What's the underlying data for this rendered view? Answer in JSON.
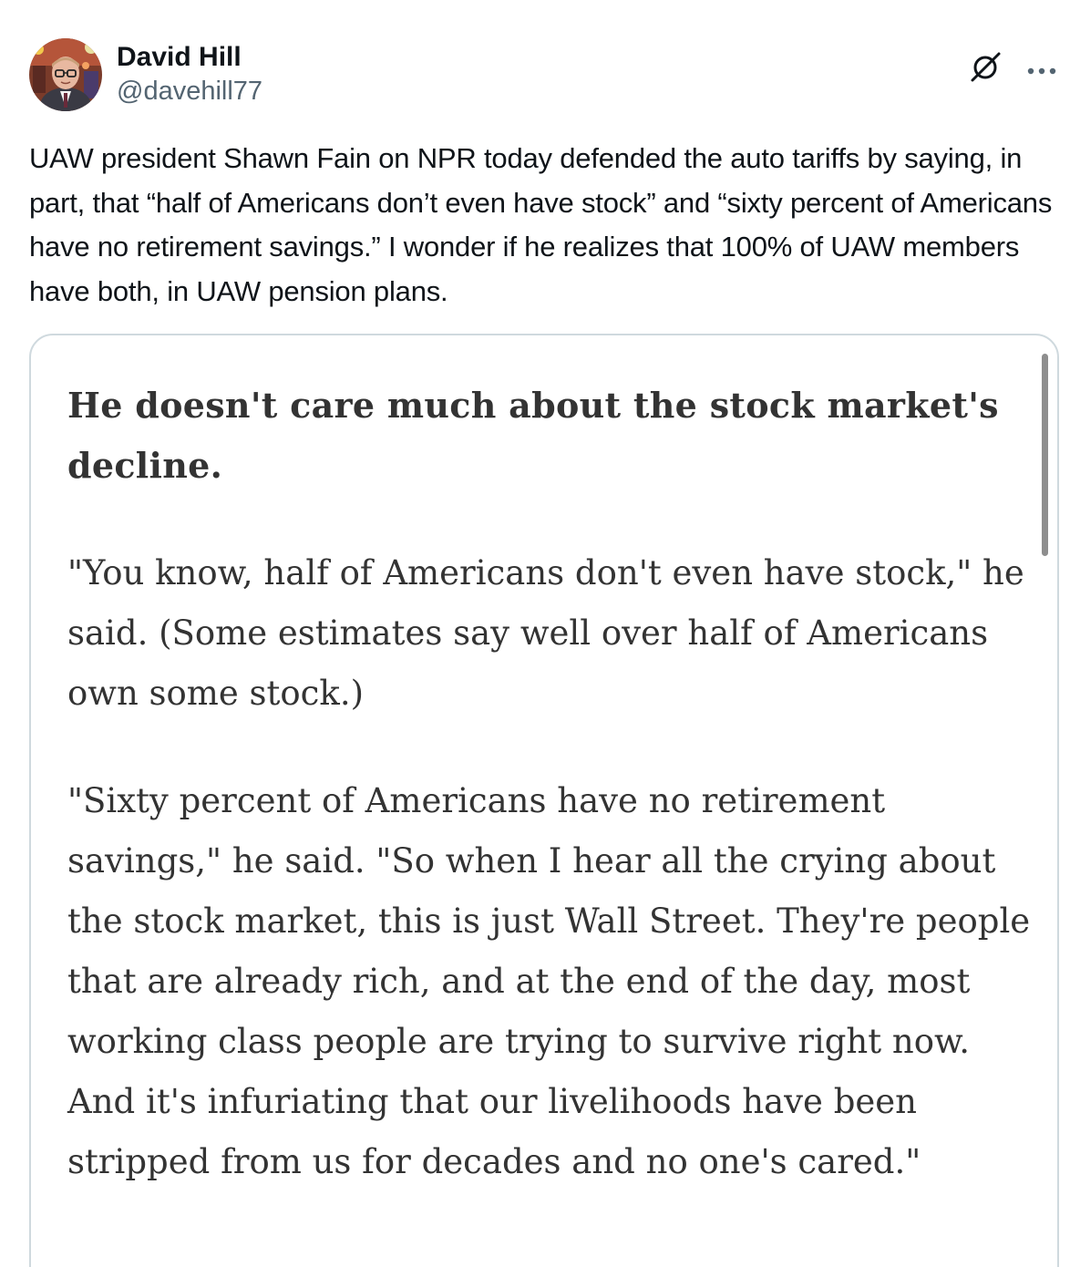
{
  "tweet": {
    "author": {
      "name": "David Hill",
      "handle": "@davehill77",
      "avatar_icon": "profile-photo"
    },
    "actions": {
      "grok_icon": "grok-slash-circle-icon",
      "more_icon": "more-horizontal-icon"
    },
    "text": "UAW president Shawn Fain on NPR today defended the auto tariffs by saying, in part, that “half of Americans don’t even have stock” and “sixty percent of Americans have no retirement savings.” I wonder if he realizes that 100% of UAW members have both, in UAW pension plans."
  },
  "media": {
    "heading": "He doesn't care much about the stock market's decline.",
    "paragraphs": [
      "\"You know, half of Americans don't even have stock,\" he said. (Some estimates say well over half of Americans own some stock.)",
      "\"Sixty percent of Americans have no retirement savings,\" he said. \"So when I hear all the crying about the stock market, this is just Wall Street. They're people that are already rich, and at the end of the day, most working class people are trying to survive right now. And it's infuriating that our livelihoods have been stripped from us for decades and no one's cared.\""
    ]
  },
  "colors": {
    "text_primary": "#0f1419",
    "text_secondary": "#536471",
    "card_border": "#cfd9de",
    "article_text": "#333333"
  }
}
